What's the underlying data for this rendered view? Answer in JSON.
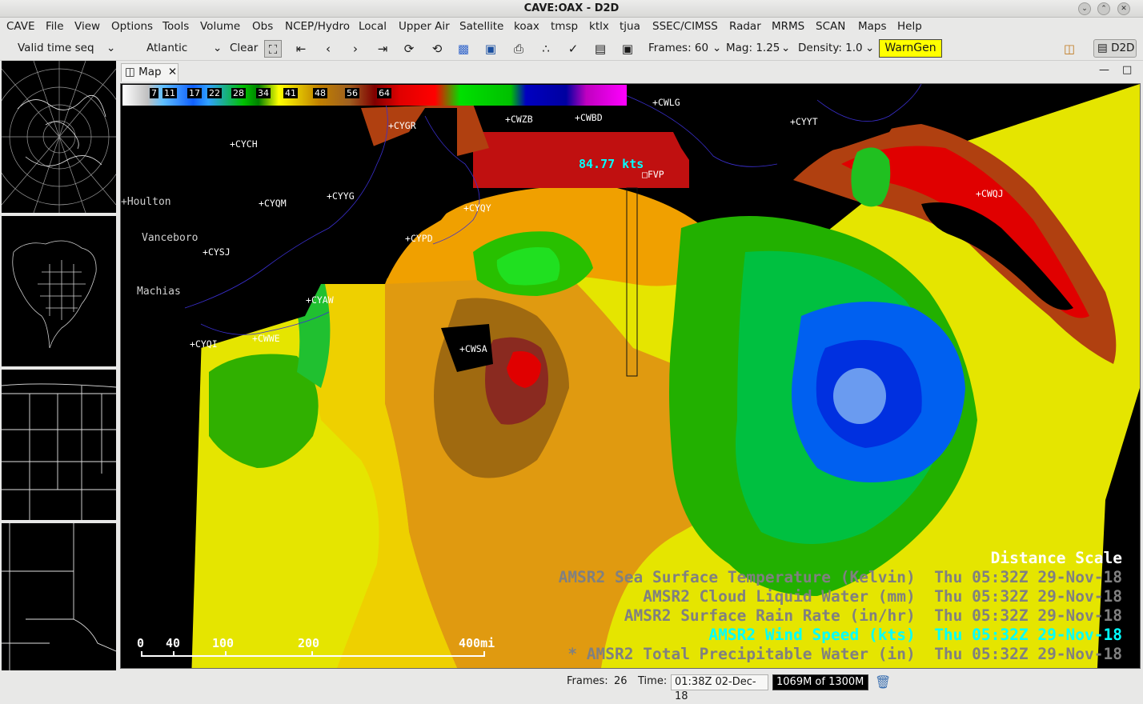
{
  "window": {
    "title": "CAVE:OAX - D2D"
  },
  "menu": [
    "CAVE",
    "File",
    "View",
    "Options",
    "Tools",
    "Volume",
    "Obs",
    "NCEP/Hydro",
    "Local",
    "Upper Air",
    "Satellite",
    "koax",
    "tmsp",
    "ktlx",
    "tjua",
    "SSEC/CIMSS",
    "Radar",
    "MRMS",
    "SCAN",
    "Maps",
    "Help"
  ],
  "toolbar": {
    "loop_mode": "Valid time seq",
    "scale": "Atlantic",
    "clear_label": "Clear",
    "frames_label": "Frames: 60",
    "mag_label": "Mag: 1.25",
    "density_label": "Density: 1.0",
    "warngen_label": "WarnGen",
    "perspective_label": "D2D"
  },
  "tab": {
    "label": "Map"
  },
  "colorbar": {
    "labels": [
      "7",
      "11",
      "17",
      "22",
      "28",
      "34",
      "41",
      "48",
      "56",
      "64"
    ]
  },
  "sample_readout": "84.77 kts",
  "stations": [
    "CWLG",
    "CYYT",
    "CYGR",
    "CWZB",
    "CWBD",
    "CYCH",
    "FVP",
    "CWQJ",
    "CYYG",
    "CYQM",
    "CYQY",
    "CYPD",
    "CYSJ",
    "CYAW",
    "CYQI",
    "CWWE",
    "CWSA"
  ],
  "towns": [
    "Houlton",
    "Vanceboro",
    "Machias"
  ],
  "legend": {
    "title": "Distance Scale",
    "lines": [
      {
        "product": "AMSR2 Sea Surface Temperature (Kelvin)",
        "time": "Thu 05:32Z 29-Nov-18",
        "color": "#808080"
      },
      {
        "product": "AMSR2 Cloud Liquid Water (mm)",
        "time": "Thu 05:32Z 29-Nov-18",
        "color": "#808080"
      },
      {
        "product": "AMSR2 Surface Rain Rate (in/hr)",
        "time": "Thu 05:32Z 29-Nov-18",
        "color": "#808080"
      },
      {
        "product": "AMSR2 Wind Speed (kts)",
        "time": "Thu 05:32Z 29-Nov-18",
        "color": "#00ffff"
      },
      {
        "product": "* AMSR2 Total Precipitable Water (in)",
        "time": "Thu 05:32Z 29-Nov-18",
        "color": "#808080"
      }
    ]
  },
  "scale_bar": [
    "0",
    "40",
    "100",
    "200",
    "400mi"
  ],
  "status": {
    "frames_label": "Frames:",
    "frames_value": "26",
    "time_label": "Time:",
    "time_value": "01:38Z 02-Dec-18",
    "memory_value": "1069M of 1300M"
  },
  "colors": {
    "accent_cyan": "#00ffff",
    "warngen": "#ffff00"
  }
}
